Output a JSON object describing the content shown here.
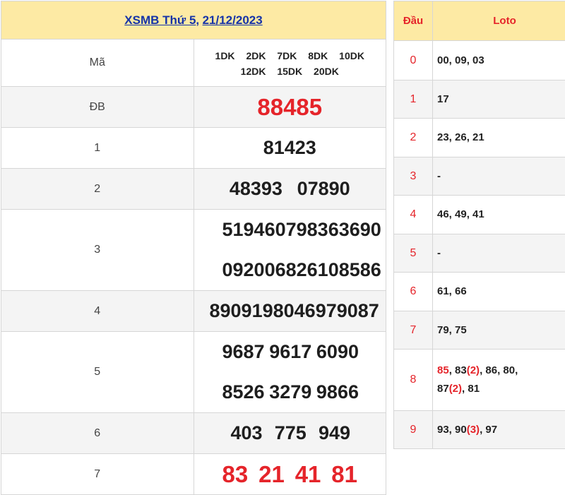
{
  "header": {
    "title_prefix": "XSMB Thứ 5",
    "separator": ",",
    "date": "21/12/2023"
  },
  "labels": {
    "ma": "Mã",
    "db": "ĐB",
    "g1": "1",
    "g2": "2",
    "g3": "3",
    "g4": "4",
    "g5": "5",
    "g6": "6",
    "g7": "7"
  },
  "ma_codes": [
    "1DK",
    "2DK",
    "7DK",
    "8DK",
    "10DK",
    "12DK",
    "15DK",
    "20DK"
  ],
  "prizes": {
    "db": "88485",
    "g1": [
      "81423"
    ],
    "g2": [
      "48393",
      "07890"
    ],
    "g3": [
      "51946",
      "07983",
      "63690",
      "09200",
      "68261",
      "08586"
    ],
    "g4": [
      "8909",
      "1980",
      "4697",
      "9087"
    ],
    "g5": [
      "9687",
      "9617",
      "6090",
      "8526",
      "3279",
      "9866"
    ],
    "g6": [
      "403",
      "775",
      "949"
    ],
    "g7": [
      "83",
      "21",
      "41",
      "81"
    ]
  },
  "loto": {
    "head_dau": "Đầu",
    "head_loto": "Loto",
    "rows": [
      {
        "dau": "0",
        "val": "00, 09, 03"
      },
      {
        "dau": "1",
        "val": "17"
      },
      {
        "dau": "2",
        "val": "23, 26, 21"
      },
      {
        "dau": "3",
        "val": "-"
      },
      {
        "dau": "4",
        "val": "46, 49, 41"
      },
      {
        "dau": "5",
        "val": "-"
      },
      {
        "dau": "6",
        "val": "61, 66"
      },
      {
        "dau": "7",
        "val": "79, 75"
      },
      {
        "dau": "8",
        "val_parts": [
          "85",
          ", 83",
          "(2)",
          ", 86, 80,",
          "87",
          "(2)",
          ", 81"
        ]
      },
      {
        "dau": "9",
        "val_parts": [
          "93, 90",
          "(3)",
          ", 97"
        ]
      }
    ]
  }
}
